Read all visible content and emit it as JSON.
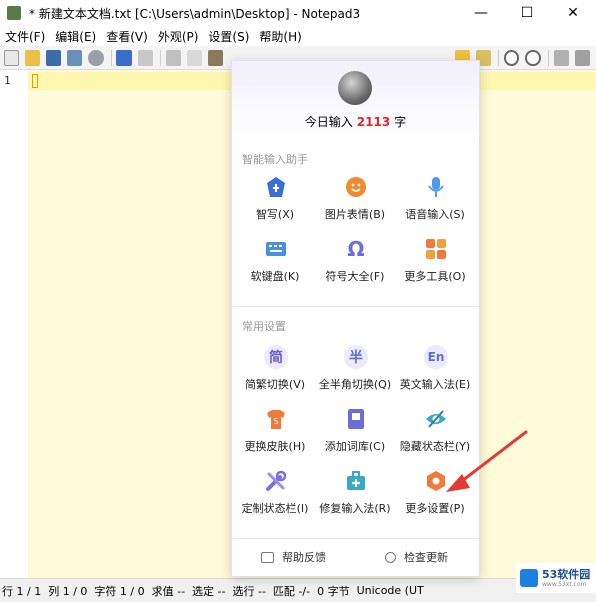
{
  "window": {
    "title": "* 新建文本文档.txt [C:\\Users\\admin\\Desktop] - Notepad3",
    "controls": [
      "—",
      "☐",
      "✕"
    ]
  },
  "menu": [
    "文件(F)",
    "编辑(E)",
    "查看(V)",
    "外观(P)",
    "设置(S)",
    "帮助(H)"
  ],
  "editor": {
    "line_number": "1"
  },
  "status": [
    "行 1 / 1",
    "列 1 / 0",
    "字符 1 / 0",
    "求值 --",
    "选定 --",
    "选行 --",
    "匹配 -/-",
    "0 字节",
    "Unicode (UT"
  ],
  "ime_panel": {
    "today_prefix": "今日输入",
    "today_count": "2113",
    "today_suffix": "字",
    "section1": "智能输入助手",
    "tools": [
      {
        "label": "智写(X)",
        "icon": "smart-write-icon",
        "color": "#3b6ed8"
      },
      {
        "label": "图片表情(B)",
        "icon": "emoji-icon",
        "color": "#f08a2c"
      },
      {
        "label": "语音输入(S)",
        "icon": "microphone-icon",
        "color": "#4b9be8"
      },
      {
        "label": "软键盘(K)",
        "icon": "keyboard-icon",
        "color": "#4a90e2"
      },
      {
        "label": "符号大全(F)",
        "icon": "omega-icon",
        "color": "#6a6fd8"
      },
      {
        "label": "更多工具(O)",
        "icon": "grid-icon",
        "color": "#f07a3c"
      }
    ],
    "section2": "常用设置",
    "settings": [
      {
        "label": "简繁切换(V)",
        "icon": "simplified-traditional-icon",
        "glyph": "简",
        "color": "#7a6fe0"
      },
      {
        "label": "全半角切换(Q)",
        "icon": "half-full-width-icon",
        "glyph": "半",
        "color": "#6a7fe0"
      },
      {
        "label": "英文输入法(E)",
        "icon": "english-input-icon",
        "glyph": "En",
        "color": "#6a7fe0"
      },
      {
        "label": "更换皮肤(H)",
        "icon": "skin-icon",
        "color": "#f07a3c"
      },
      {
        "label": "添加词库(C)",
        "icon": "dictionary-icon",
        "color": "#6a6fd8"
      },
      {
        "label": "隐藏状态栏(Y)",
        "icon": "hide-statusbar-icon",
        "color": "#3aa8c8"
      },
      {
        "label": "定制状态栏(I)",
        "icon": "custom-statusbar-icon",
        "color": "#7a6fe0"
      },
      {
        "label": "修复输入法(R)",
        "icon": "repair-icon",
        "color": "#3aa8c8"
      },
      {
        "label": "更多设置(P)",
        "icon": "more-settings-icon",
        "color": "#f07a3c"
      }
    ],
    "footer": {
      "feedback": "帮助反馈",
      "update": "检查更新"
    }
  },
  "watermark": {
    "title": "53软件园",
    "sub": "www.53xt.com"
  }
}
